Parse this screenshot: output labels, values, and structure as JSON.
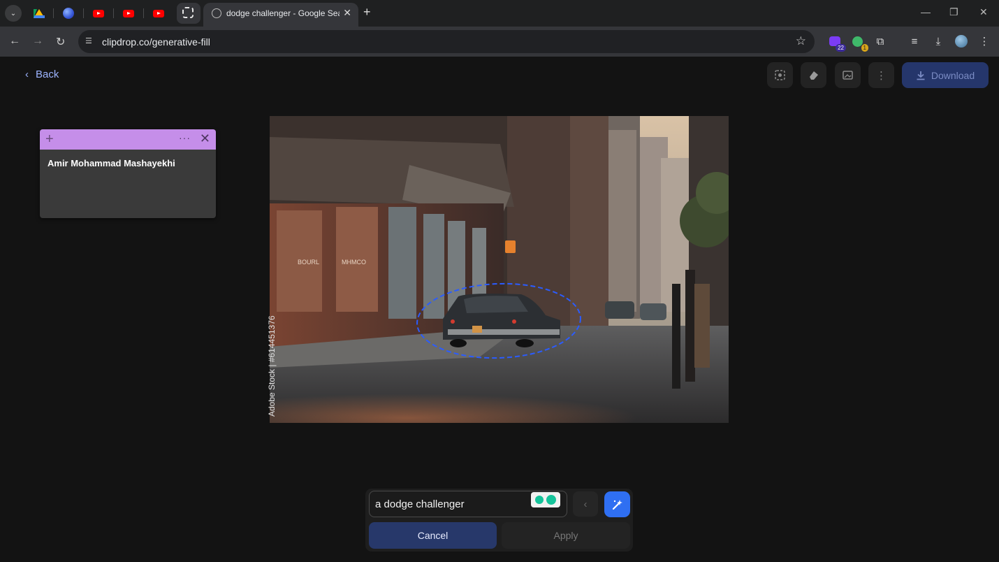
{
  "browser": {
    "active_tab_title": "dodge challenger - Google Sea",
    "url": "clipdrop.co/generative-fill",
    "extension_badges": {
      "first": "22",
      "second": "1"
    }
  },
  "app": {
    "back_label": "Back",
    "download_label": "Download"
  },
  "note": {
    "author": "Amir Mohammad Mashayekhi"
  },
  "photo": {
    "watermark": "Adobe Stock | #614451376",
    "sign_1": "BOURL",
    "sign_2": "MHMCO"
  },
  "prompt": {
    "value": "a dodge challenger",
    "cancel_label": "Cancel",
    "apply_label": "Apply"
  },
  "colors": {
    "accent": "#2f6ff2",
    "note": "#c58ee9",
    "selection": "#2b5cff"
  }
}
